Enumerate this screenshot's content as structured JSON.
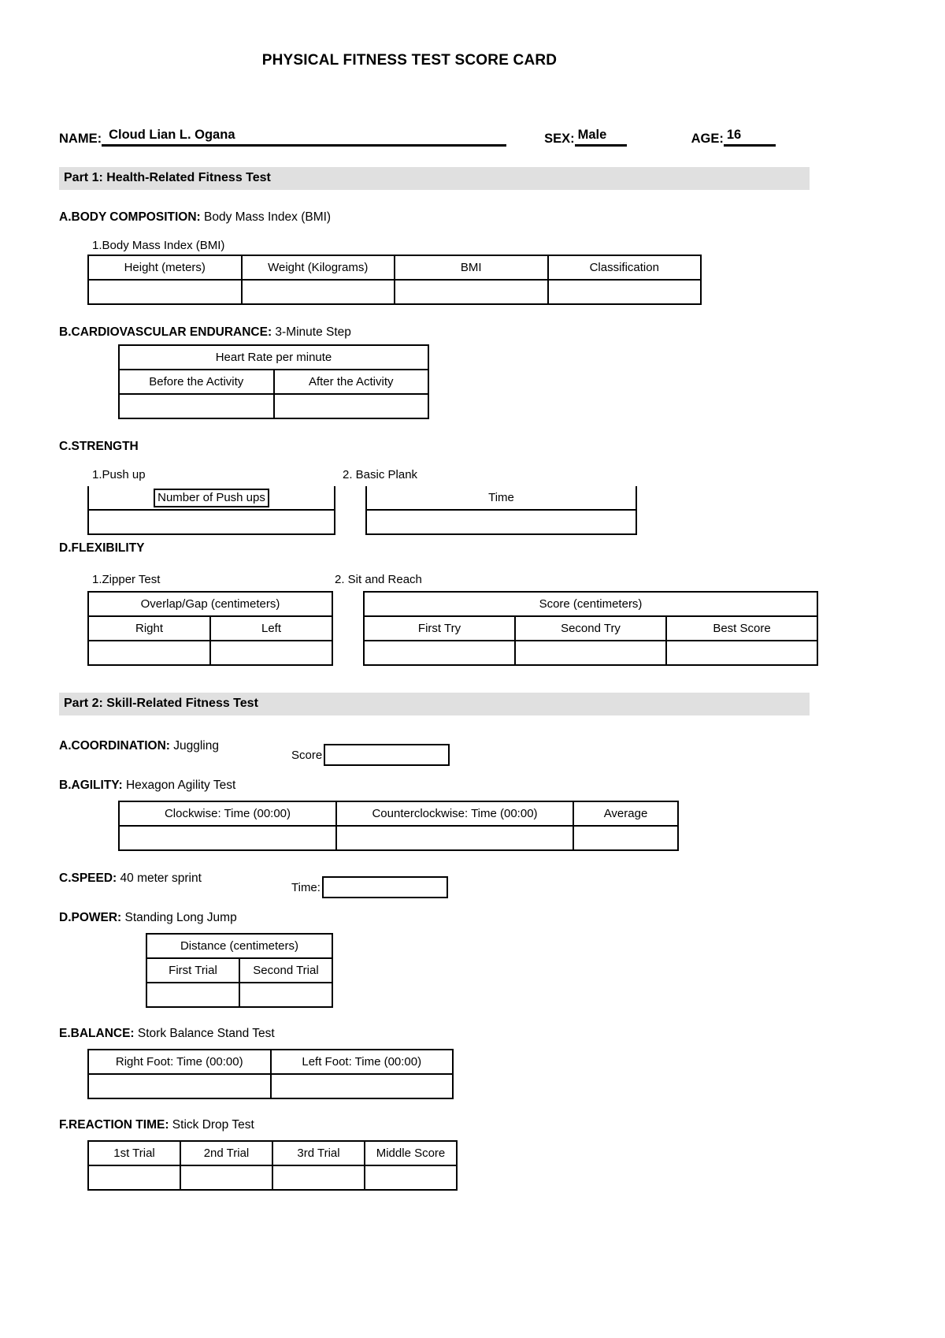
{
  "document": {
    "title": "PHYSICAL FITNESS TEST SCORE CARD"
  },
  "student": {
    "name_label": "NAME:",
    "name_value": "Cloud Lian L. Ogana",
    "sex_label": "SEX:",
    "sex_value": "Male",
    "age_label": "AGE:",
    "age_value": "16"
  },
  "part1": {
    "banner": "Part 1: Health-Related Fitness Test",
    "a": {
      "heading_bold": "A.BODY COMPOSITION:",
      "heading_plain": " Body Mass Index (BMI)",
      "sub_label": "1.Body Mass Index (BMI)",
      "headers": [
        "Height (meters)",
        "Weight (Kilograms)",
        "BMI",
        "Classification"
      ],
      "values": [
        "",
        "",
        "",
        ""
      ]
    },
    "b": {
      "heading_bold": "B.CARDIOVASCULAR ENDURANCE:",
      "heading_plain": " 3-Minute Step",
      "group_header": "Heart Rate per minute",
      "headers": [
        "Before the Activity",
        "After the Activity"
      ],
      "values": [
        "",
        ""
      ]
    },
    "c": {
      "heading_bold": "C.STRENGTH",
      "pushup": {
        "sub_label": "1.Push up",
        "header": "Number of Push ups",
        "value": ""
      },
      "plank": {
        "sub_label": "2. Basic Plank",
        "header": "Time",
        "value": ""
      }
    },
    "d": {
      "heading_bold": "D.FLEXIBILITY",
      "zipper": {
        "sub_label": "1.Zipper Test",
        "group_header": "Overlap/Gap (centimeters)",
        "headers": [
          "Right",
          "Left"
        ],
        "values": [
          "",
          ""
        ]
      },
      "sitreach": {
        "sub_label": "2. Sit and Reach",
        "group_header": "Score (centimeters)",
        "headers": [
          "First Try",
          "Second Try",
          "Best Score"
        ],
        "values": [
          "",
          "",
          ""
        ]
      }
    }
  },
  "part2": {
    "banner": "Part 2: Skill-Related Fitness Test",
    "a": {
      "heading_bold": "A.COORDINATION:",
      "heading_plain": " Juggling",
      "score_label": "Score",
      "score_value": ""
    },
    "b": {
      "heading_bold": "B.AGILITY:",
      "heading_plain": " Hexagon Agility Test",
      "headers": [
        "Clockwise: Time (00:00)",
        "Counterclockwise: Time (00:00)",
        "Average"
      ],
      "values": [
        "",
        "",
        ""
      ]
    },
    "c": {
      "heading_bold": "C.SPEED:",
      "heading_plain": " 40 meter sprint",
      "time_label": "Time:",
      "time_value": ""
    },
    "d": {
      "heading_bold": "D.POWER:",
      "heading_plain": " Standing Long Jump",
      "group_header": "Distance (centimeters)",
      "headers": [
        "First Trial",
        "Second Trial"
      ],
      "values": [
        "",
        ""
      ]
    },
    "e": {
      "heading_bold": "E.BALANCE:",
      "heading_plain": " Stork Balance Stand Test",
      "headers": [
        "Right Foot: Time (00:00)",
        "Left Foot: Time (00:00)"
      ],
      "values": [
        "",
        ""
      ]
    },
    "f": {
      "heading_bold": "F.REACTION TIME:",
      "heading_plain": " Stick Drop Test",
      "headers": [
        "1st Trial",
        "2nd Trial",
        "3rd Trial",
        "Middle Score"
      ],
      "values": [
        "",
        "",
        "",
        ""
      ]
    }
  }
}
